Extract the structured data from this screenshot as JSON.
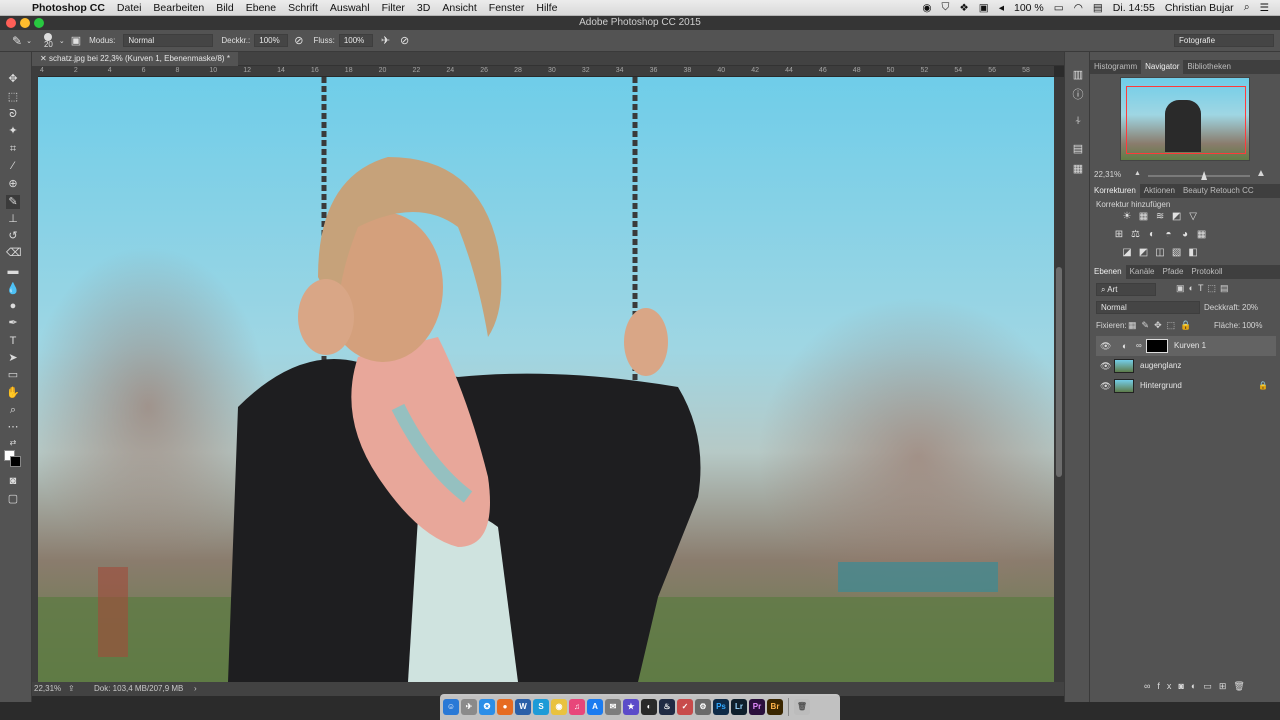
{
  "menubar": {
    "app": "Photoshop CC",
    "items": [
      "Datei",
      "Bearbeiten",
      "Bild",
      "Ebene",
      "Schrift",
      "Auswahl",
      "Filter",
      "3D",
      "Ansicht",
      "Fenster",
      "Hilfe"
    ],
    "battery": "100 %",
    "clock": "Di. 14:55",
    "user": "Christian Bujar"
  },
  "window": {
    "title": "Adobe Photoshop CC 2015"
  },
  "options": {
    "brush_size": "20",
    "mode_label": "Modus:",
    "mode_value": "Normal",
    "opacity_label": "Deckkr.:",
    "opacity_value": "100%",
    "flow_label": "Fluss:",
    "flow_value": "100%",
    "workspace": "Fotografie"
  },
  "document": {
    "tab_title": "schatz.jpg bei 22,3% (Kurven 1, Ebenenmaske/8) *",
    "ruler_marks": [
      "4",
      "2",
      "4",
      "6",
      "8",
      "10",
      "12",
      "14",
      "16",
      "18",
      "20",
      "22",
      "24",
      "26",
      "28",
      "30",
      "32",
      "34",
      "36",
      "38",
      "40",
      "42",
      "44",
      "46",
      "48",
      "50",
      "52",
      "54",
      "56",
      "58"
    ],
    "zoom": "22,31%",
    "doc_info": "Dok: 103,4 MB/207,9 MB"
  },
  "navigator": {
    "tabs": [
      "Histogramm",
      "Navigator",
      "Bibliotheken"
    ],
    "active_tab": "Navigator",
    "zoom": "22,31%",
    "zoom_level": 0.55
  },
  "adjustments": {
    "tabs": [
      "Korrekturen",
      "Aktionen",
      "Beauty Retouch CC"
    ],
    "active_tab": "Korrekturen",
    "add_label": "Korrektur hinzufügen",
    "row1": [
      "☀",
      "▦",
      "≋",
      "◩",
      "▽"
    ],
    "row2": [
      "⊞",
      "⚖",
      "◐",
      "◓",
      "◕",
      "▦"
    ],
    "row3": [
      "◪",
      "◩",
      "◫",
      "▧",
      "◧"
    ]
  },
  "layers": {
    "tabs": [
      "Ebenen",
      "Kanäle",
      "Pfade",
      "Protokoll"
    ],
    "active_tab": "Ebenen",
    "filter_kind": "Art",
    "blend_mode": "Normal",
    "opacity_label": "Deckkraft:",
    "opacity_value": "20%",
    "lock_label": "Fixieren:",
    "fill_label": "Fläche:",
    "fill_value": "100%",
    "items": [
      {
        "name": "Kurven 1",
        "selected": true
      },
      {
        "name": "augenglanz",
        "selected": false
      },
      {
        "name": "Hintergrund",
        "selected": false
      }
    ]
  },
  "colors": {
    "panel": "#535353",
    "dark": "#3f3f3f",
    "selected_layer": "#636363"
  }
}
